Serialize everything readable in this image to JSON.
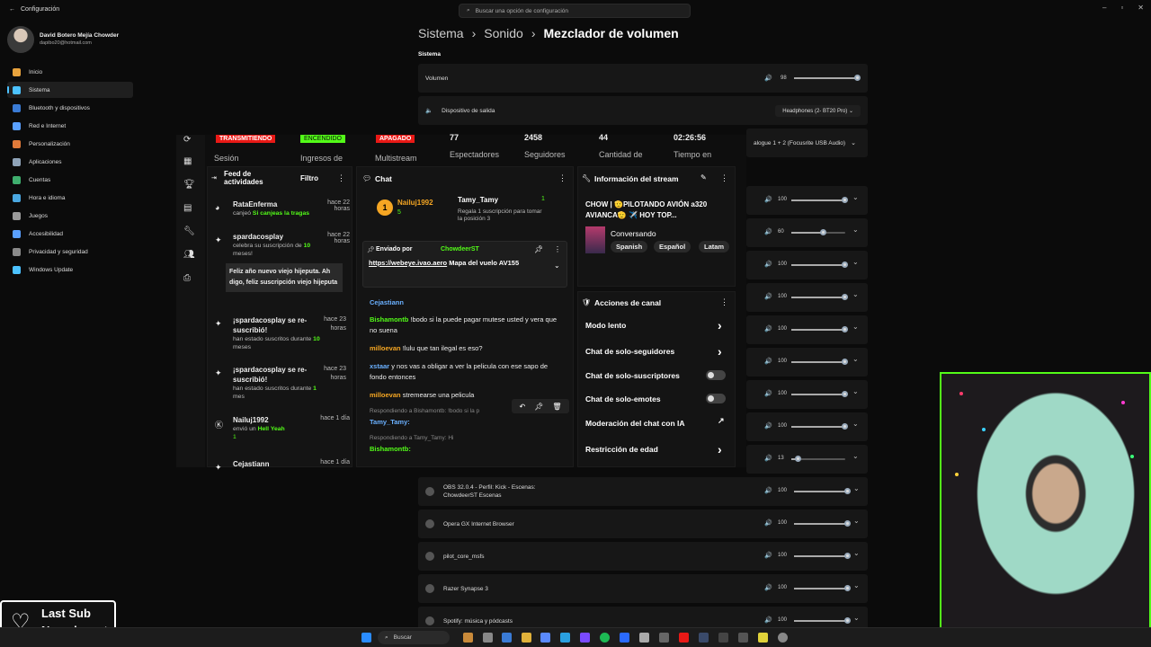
{
  "window": {
    "title": "Configuración"
  },
  "user": {
    "name": "David Botero Mejía Chowder",
    "email": "dapibo20@hotmail.com"
  },
  "search": {
    "placeholder": "Buscar una opción de configuración"
  },
  "nav": [
    {
      "label": "Inicio",
      "color": "#e8a33d"
    },
    {
      "label": "Sistema",
      "color": "#4cc2ff"
    },
    {
      "label": "Bluetooth y dispositivos",
      "color": "#3a7bd5"
    },
    {
      "label": "Red e Internet",
      "color": "#5aa0ff"
    },
    {
      "label": "Personalización",
      "color": "#e07a3a"
    },
    {
      "label": "Aplicaciones",
      "color": "#8fa3b8"
    },
    {
      "label": "Cuentas",
      "color": "#3fae6e"
    },
    {
      "label": "Hora e idioma",
      "color": "#4aa7e0"
    },
    {
      "label": "Juegos",
      "color": "#9a9a9a"
    },
    {
      "label": "Accesibilidad",
      "color": "#5aa0ff"
    },
    {
      "label": "Privacidad y seguridad",
      "color": "#8a8a8a"
    },
    {
      "label": "Windows Update",
      "color": "#4cc2ff"
    }
  ],
  "breadcrumb": {
    "a": "Sistema",
    "b": "Sonido",
    "c": "Mezclador de volumen",
    "sep": "›"
  },
  "section": "Sistema",
  "volume": {
    "label": "Volumen",
    "value": "98",
    "level": 0.98
  },
  "output": {
    "label": "Dispositivo de salida",
    "device": "Headphones (2- BT20 Pro)"
  },
  "input_device": "alogue 1 + 2 (Focusrite USB Audio)",
  "app_levels": [
    {
      "value": "100",
      "level": 1
    },
    {
      "value": "60",
      "level": 0.6
    },
    {
      "value": "100",
      "level": 1
    },
    {
      "value": "100",
      "level": 1
    },
    {
      "value": "100",
      "level": 1
    },
    {
      "value": "100",
      "level": 1
    },
    {
      "value": "100",
      "level": 1
    },
    {
      "value": "100",
      "level": 1
    },
    {
      "value": "13",
      "level": 0.13
    }
  ],
  "apps": [
    {
      "name": "OBS 32.0.4 - Perfil: Kick - Escenas: ChowdeerST Escenas",
      "value": "100"
    },
    {
      "name": "Opera GX Internet Browser",
      "value": "100"
    },
    {
      "name": "pilot_core_msfs",
      "value": "100"
    },
    {
      "name": "Razer Synapse 3",
      "value": "100"
    },
    {
      "name": "Spotify: música y pódcasts",
      "value": "100"
    }
  ],
  "kick": {
    "badges": {
      "live": "TRANSMITIENDO",
      "on": "ENCENDIDO",
      "off": "APAGADO"
    },
    "stats": {
      "session": "Sesión",
      "income": "Ingresos de",
      "multi": "Multistream",
      "viewers_val": "77",
      "viewers": "Espectadores",
      "followers_val": "2458",
      "followers": "Seguidores",
      "amount_val": "44",
      "amount": "Cantidad de",
      "time_val": "02:26:56",
      "time": "Tiempo en"
    },
    "feed": {
      "title": "Feed de actividades",
      "filter": "Filtro",
      "items": [
        {
          "user": "RataEnferma",
          "time": "hace 22 horas",
          "line1": "canjeó ",
          "line1b": "Si canjeas la tragas"
        },
        {
          "user": "spardacosplay",
          "time": "hace 22 horas",
          "line1": "celebra su suscripción de ",
          "line1b": "10",
          "line2": "meses!",
          "msg": "Feliz año nuevo viejo hijeputa. Ah digo, feliz suscripción viejo hijeputa"
        },
        {
          "user": "¡spardacosplay se re-suscribió!",
          "time": "hace 23 horas",
          "line1": "han estado suscritos durante ",
          "line1b": "10",
          "line2": "meses"
        },
        {
          "user": "¡spardacosplay se re-suscribió!",
          "time": "hace 23 horas",
          "line1": "han estado suscritos durante ",
          "line1b": "1",
          "line2": "mes"
        },
        {
          "user": "Nailuj1992",
          "time": "hace 1 día",
          "line1": "envió un ",
          "line1b": "Hell Yeah",
          "line2": "1"
        },
        {
          "user": "Cejastiann",
          "time": "hace 1 día"
        }
      ]
    },
    "chat": {
      "title": "Chat",
      "top1": "Nailuj1992",
      "top1_count": "5",
      "top2": "Tamy_Tamy",
      "top2_count": "1",
      "top2_note": "Regala 1 suscripción para tomar la posición 3",
      "pinned_by": "Enviado por",
      "pinned_user": "ChowdeerST",
      "pinned_link": "https://webeye.ivao.aero",
      "pinned_text": " Mapa del vuelo AV155",
      "messages": [
        {
          "user": "Cejastiann",
          "color": "#6ab0ff",
          "text": ""
        },
        {
          "user": "Bishamontb",
          "color": "#53fc18",
          "text": " !bodo si la puede pagar mutese usted y vera que no suena"
        },
        {
          "user": "milloevan",
          "color": "#f5a623",
          "text": " !lulu que tan ilegal es eso?"
        },
        {
          "user": "xstaar",
          "color": "#6ab0ff",
          "text": " y nos vas a obligar a ver la pelicula con ese sapo de fondo entonces"
        },
        {
          "user": "milloevan",
          "color": "#f5a623",
          "text": " stremearse una pelicula"
        }
      ],
      "reply1": "Respondiendo a Bishamontb: !bodo si la p",
      "reply_user1": "Tamy_Tamy:",
      "reply2": "Respondiendo a Tamy_Tamy: Hi",
      "reply_user2": "Bishamontb:"
    },
    "stream": {
      "title": "Información del stream",
      "name": "CHOW | 🫡PILOTANDO AVIÓN a320 AVIANCA🫡 ✈️ HOY TOP...",
      "category": "Conversando",
      "tags": [
        "Spanish",
        "Español",
        "Latam"
      ]
    },
    "actions": {
      "title": "Acciones de canal",
      "items": [
        "Modo lento",
        "Chat de solo-seguidores",
        "Chat de solo-suscriptores",
        "Chat de solo-emotes",
        "Moderación del chat con IA",
        "Restricción de edad"
      ]
    }
  },
  "lastsub": {
    "title": "Last Sub",
    "text": "No subs yet"
  },
  "taskbar": {
    "search": "Buscar"
  }
}
